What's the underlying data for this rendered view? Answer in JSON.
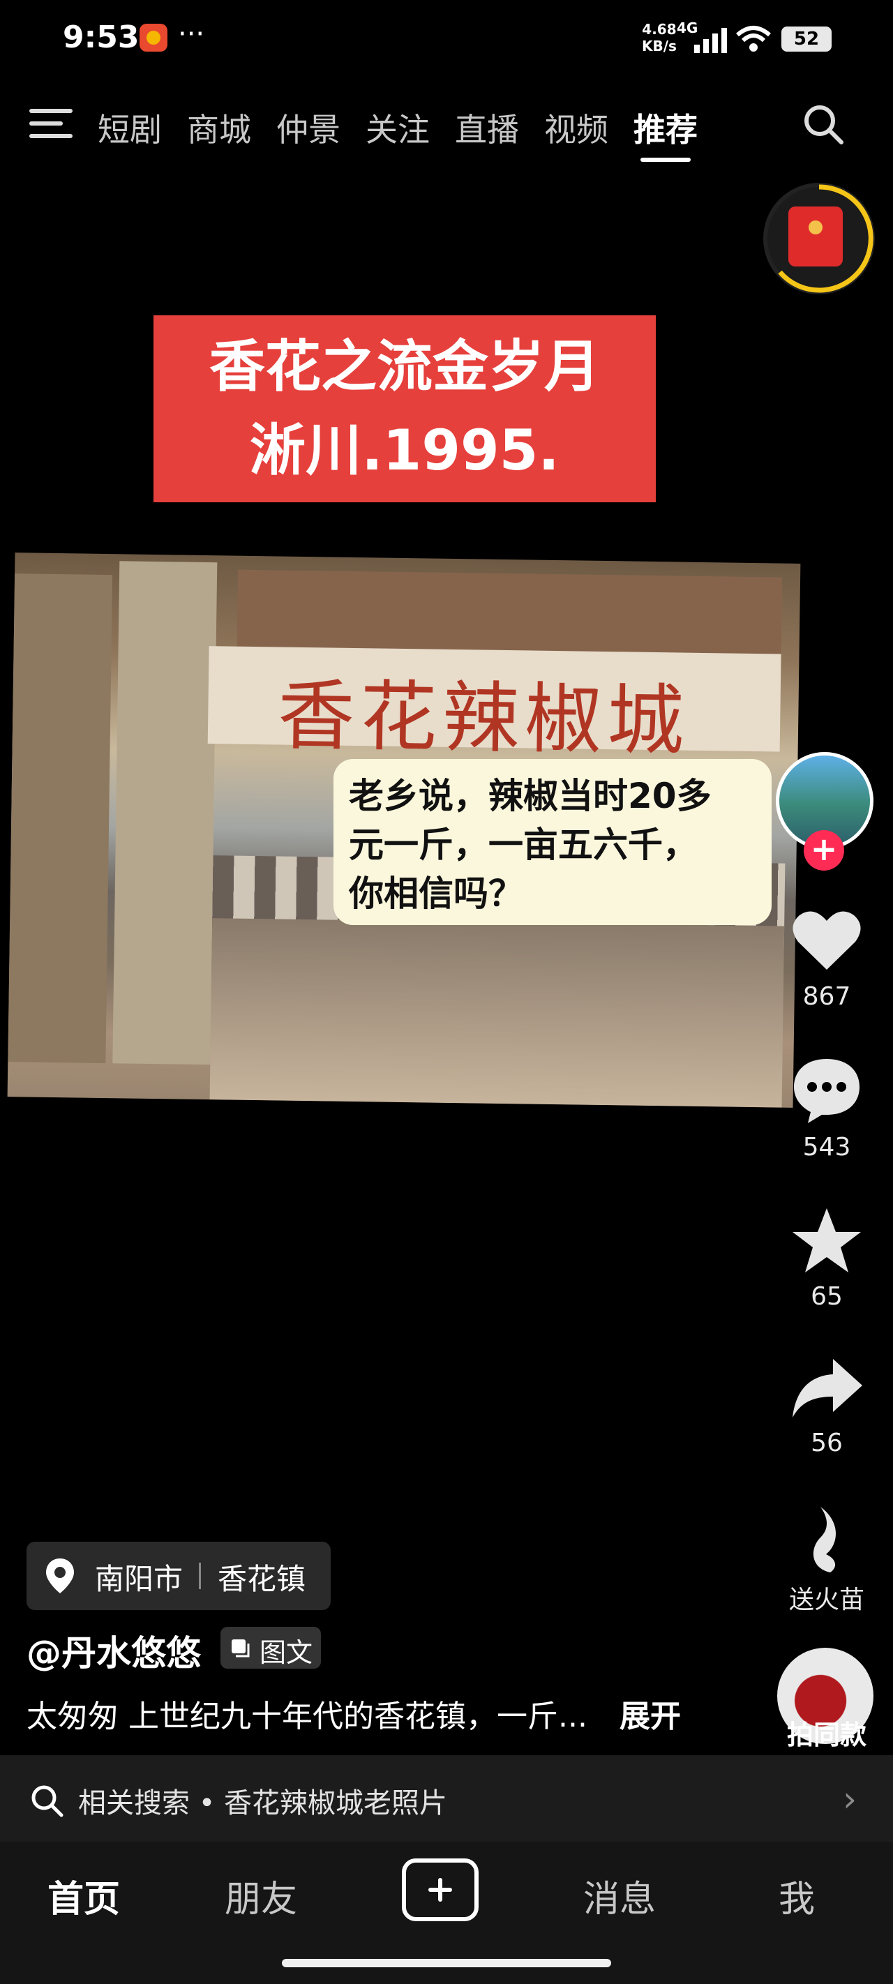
{
  "status_bar": {
    "time": "9:53",
    "more": "···",
    "speed_value": "4.68",
    "speed_unit": "KB/s",
    "network": "4G",
    "battery": "52",
    "icons": [
      "app-notification-icon",
      "signal-icon",
      "wifi-icon",
      "battery-icon"
    ]
  },
  "top_nav": {
    "tabs": [
      "短剧",
      "商城",
      "仲景",
      "关注",
      "直播",
      "视频",
      "推荐"
    ],
    "active_tab": "推荐",
    "icons": [
      "menu-icon",
      "search-icon"
    ]
  },
  "banner": {
    "line1": "香花之流金岁月",
    "line2": "淅川.1995."
  },
  "photo": {
    "sign_text": "香花辣椒城",
    "bubble_line1": "老乡说，辣椒当时20多",
    "bubble_line2": "元一斤，一亩五六千，",
    "bubble_line3": "你相信吗？"
  },
  "right_rail": {
    "follow": "+",
    "like_count": "867",
    "comment_count": "543",
    "favorite_count": "65",
    "share_count": "56",
    "fire_label": "送火苗",
    "music_label": "拍同款"
  },
  "post": {
    "location_city": "南阳市",
    "location_town": "香花镇",
    "author": "@丹水悠悠",
    "tag": "图文",
    "caption": "太匆匆 上世纪九十年代的香花镇，一斤...",
    "expand": "展开"
  },
  "related_search": {
    "text": "相关搜索 • 香花辣椒城老照片",
    "chevron": "›"
  },
  "bottom_nav": {
    "home": "首页",
    "friends": "朋友",
    "messages": "消息",
    "me": "我"
  }
}
